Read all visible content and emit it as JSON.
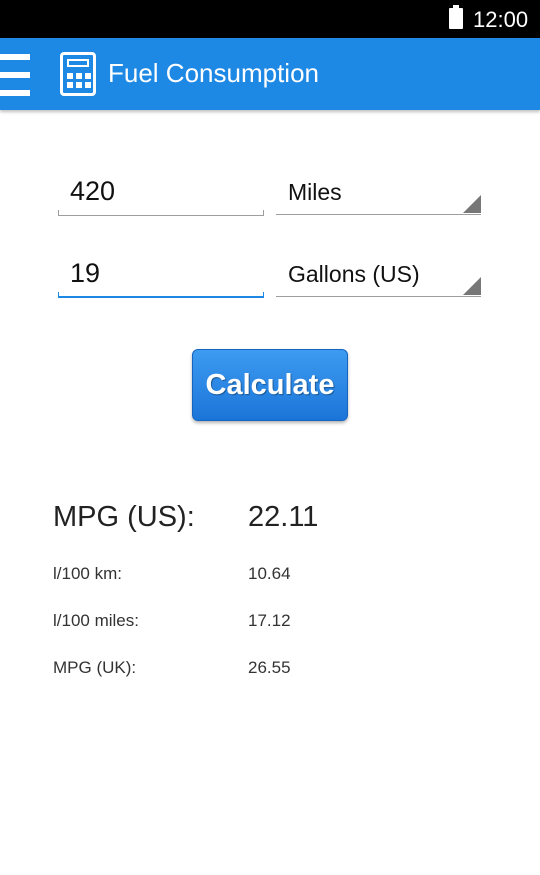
{
  "status_bar": {
    "time": "12:00",
    "battery_icon": "battery-full-icon"
  },
  "app_bar": {
    "title": "Fuel Consumption",
    "menu_icon": "hamburger-menu-icon",
    "app_icon": "calculator-icon",
    "color": "#1e88e5"
  },
  "form": {
    "distance": {
      "value": "420",
      "unit": "Miles"
    },
    "fuel": {
      "value": "19",
      "unit": "Gallons (US)"
    },
    "calculate_label": "Calculate"
  },
  "results": {
    "primary": {
      "label": "MPG (US):",
      "value": "22.11"
    },
    "rows": [
      {
        "label": "l/100 km:",
        "value": "10.64"
      },
      {
        "label": "l/100 miles:",
        "value": "17.12"
      },
      {
        "label": "MPG (UK):",
        "value": "26.55"
      }
    ]
  }
}
